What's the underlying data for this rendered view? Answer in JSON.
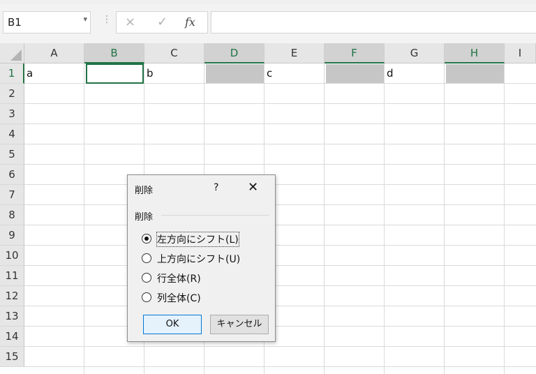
{
  "formula_bar": {
    "name_box": "B1",
    "name_box_arrow": "▾",
    "separator": "⋮",
    "cancel_icon": "×",
    "enter_icon": "✓",
    "fx_label": "fx",
    "formula": ""
  },
  "columns": [
    "A",
    "B",
    "C",
    "D",
    "E",
    "F",
    "G",
    "H",
    "I"
  ],
  "selected_columns": [
    "B",
    "D",
    "F",
    "H"
  ],
  "rows": [
    "1",
    "2",
    "3",
    "4",
    "5",
    "6",
    "7",
    "8",
    "9",
    "10",
    "11",
    "12",
    "13",
    "14",
    "15"
  ],
  "cells": {
    "A1": "a",
    "C1": "b",
    "E1": "c",
    "G1": "d"
  },
  "dialog": {
    "title": "削除",
    "help": "?",
    "close": "✕",
    "group_label": "削除",
    "options": [
      {
        "label": "左方向にシフト(L)",
        "selected": true
      },
      {
        "label": "上方向にシフト(U)",
        "selected": false
      },
      {
        "label": "行全体(R)",
        "selected": false
      },
      {
        "label": "列全体(C)",
        "selected": false
      }
    ],
    "ok_label": "OK",
    "cancel_label": "キャンセル"
  },
  "colors": {
    "accent": "#217346",
    "selected_fill": "#c6c6c6"
  }
}
